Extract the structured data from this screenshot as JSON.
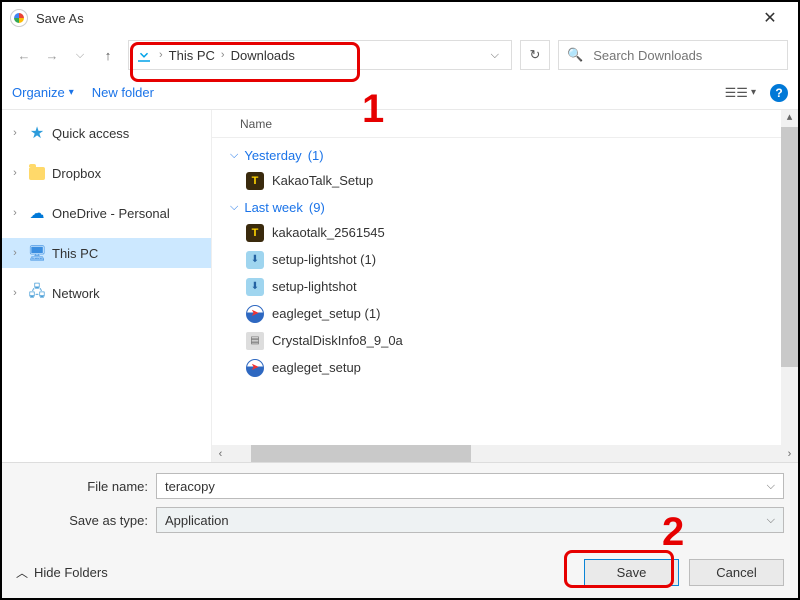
{
  "window": {
    "title": "Save As"
  },
  "breadcrumb": {
    "items": [
      "This PC",
      "Downloads"
    ]
  },
  "search": {
    "placeholder": "Search Downloads"
  },
  "toolbar": {
    "organize": "Organize",
    "newfolder": "New folder"
  },
  "sidebar": {
    "items": [
      {
        "label": "Quick access",
        "icon": "star"
      },
      {
        "label": "Dropbox",
        "icon": "folder"
      },
      {
        "label": "OneDrive - Personal",
        "icon": "cloud"
      },
      {
        "label": "This PC",
        "icon": "pc",
        "selected": true
      },
      {
        "label": "Network",
        "icon": "network"
      }
    ]
  },
  "filelist": {
    "column": "Name",
    "groups": [
      {
        "label": "Yesterday",
        "count": "(1)",
        "items": [
          {
            "name": "KakaoTalk_Setup",
            "icon": "kakao"
          }
        ]
      },
      {
        "label": "Last week",
        "count": "(9)",
        "items": [
          {
            "name": "kakaotalk_2561545",
            "icon": "kakao"
          },
          {
            "name": "setup-lightshot (1)",
            "icon": "installer"
          },
          {
            "name": "setup-lightshot",
            "icon": "installer"
          },
          {
            "name": "eagleget_setup (1)",
            "icon": "eagle"
          },
          {
            "name": "CrystalDiskInfo8_9_0a",
            "icon": "cdi"
          },
          {
            "name": "eagleget_setup",
            "icon": "eagle"
          }
        ]
      }
    ]
  },
  "form": {
    "filename_label": "File name:",
    "filename_value": "teracopy",
    "type_label": "Save as type:",
    "type_value": "Application"
  },
  "buttons": {
    "save": "Save",
    "cancel": "Cancel",
    "hide": "Hide Folders"
  },
  "annotations": {
    "one": "1",
    "two": "2"
  }
}
